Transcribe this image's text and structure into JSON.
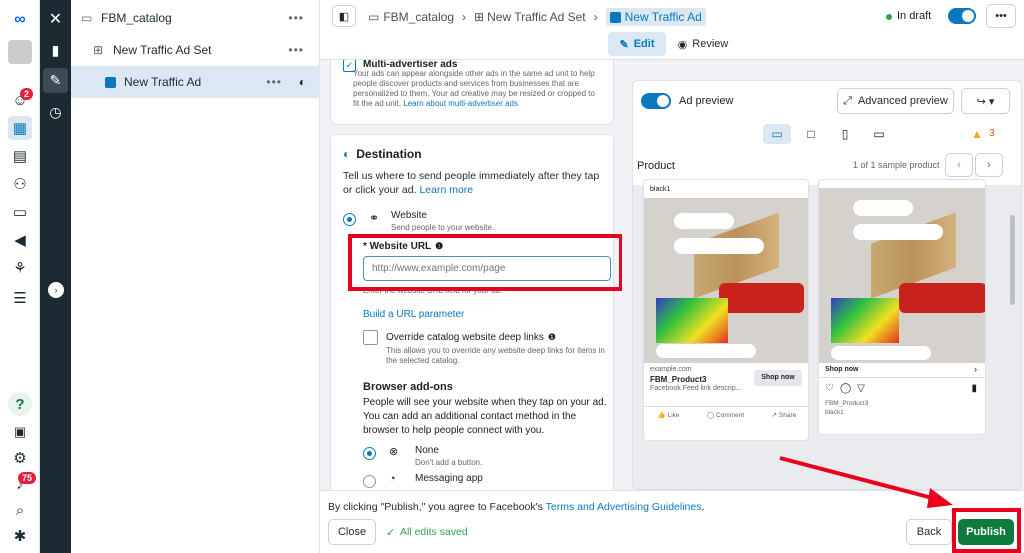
{
  "tree": {
    "catalog": "FBM_catalog",
    "adset": "New Traffic Ad Set",
    "ad": "New Traffic Ad"
  },
  "rail": {
    "notif_badge": "2",
    "bell_badge": "75"
  },
  "top": {
    "crumb1": "FBM_catalog",
    "crumb2": "New Traffic Ad Set",
    "crumb3": "New Traffic Ad",
    "status": "In draft",
    "edit": "Edit",
    "review": "Review"
  },
  "multi": {
    "title": "Multi-advertiser ads",
    "desc": "Your ads can appear alongside other ads in the same ad unit to help people discover products and services from businesses that are personalized to them. Your ad creative may be resized or cropped to fit the ad unit.",
    "link": "Learn about multi-advertiser ads"
  },
  "dest": {
    "title": "Destination",
    "desc": "Tell us where to send people immediately after they tap or click your ad.",
    "learn": "Learn more",
    "website": "Website",
    "website_sub": "Send people to your website.",
    "url_label": "* Website URL",
    "url_placeholder": "http://www.example.com/page",
    "url_help": "Enter the website URL field for your ad.",
    "build": "Build a URL parameter",
    "override": "Override catalog website deep links",
    "override_sub": "This allows you to override any website deep links for items in the selected catalog."
  },
  "addons": {
    "title": "Browser add-ons",
    "desc": "People will see your website when they tap on your ad. You can add an additional contact method in the browser to help people connect with you.",
    "none": "None",
    "none_sub": "Don't add a button.",
    "messaging": "Messaging app"
  },
  "preview": {
    "toggle": "Ad preview",
    "advanced": "Advanced preview",
    "warn_count": "3",
    "product_label": "Product",
    "sample": "1 of 1 sample product",
    "ad1": {
      "brand": "black1",
      "domain": "example.com",
      "product": "FBM_Product3",
      "feed": "Facebook Feed link descrip...",
      "cta": "Shop now",
      "like": "Like",
      "comment": "Comment",
      "share": "Share"
    },
    "ad2": {
      "shop": "Shop now",
      "name": "FBM_Product3",
      "brand": "black1"
    }
  },
  "footer": {
    "notice_pre": "By clicking \"Publish,\" you agree to Facebook's",
    "terms": "Terms and Advertising Guidelines",
    "close": "Close",
    "saved": "All edits saved",
    "back": "Back",
    "publish": "Publish"
  },
  "colors": {
    "accent": "#0a78be",
    "publish": "#0e7a3e",
    "red": "#e8001c",
    "dark": "#1c2b33"
  }
}
